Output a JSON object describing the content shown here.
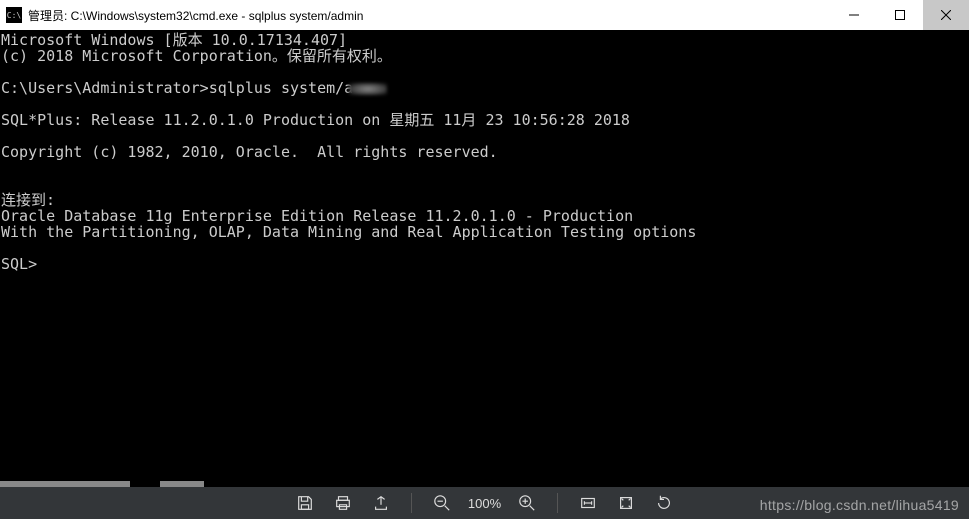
{
  "titlebar": {
    "icon_text": "C:\\",
    "title": "管理员: C:\\Windows\\system32\\cmd.exe - sqlplus  system/admin"
  },
  "terminal": {
    "lines": [
      "Microsoft Windows [版本 10.0.17134.407]",
      "(c) 2018 Microsoft Corporation。保留所有权利。",
      "",
      "C:\\Users\\Administrator>sqlplus system/a",
      "",
      "SQL*Plus: Release 11.2.0.1.0 Production on 星期五 11月 23 10:56:28 2018",
      "",
      "Copyright (c) 1982, 2010, Oracle.  All rights reserved.",
      "",
      "",
      "连接到:",
      "Oracle Database 11g Enterprise Edition Release 11.2.0.1.0 - Production",
      "With the Partitioning, OLAP, Data Mining and Real Application Testing options",
      "",
      "SQL>"
    ],
    "smudge_line_index": 3
  },
  "bottombar": {
    "zoom": "100%"
  },
  "watermark": "https://blog.csdn.net/lihua5419"
}
